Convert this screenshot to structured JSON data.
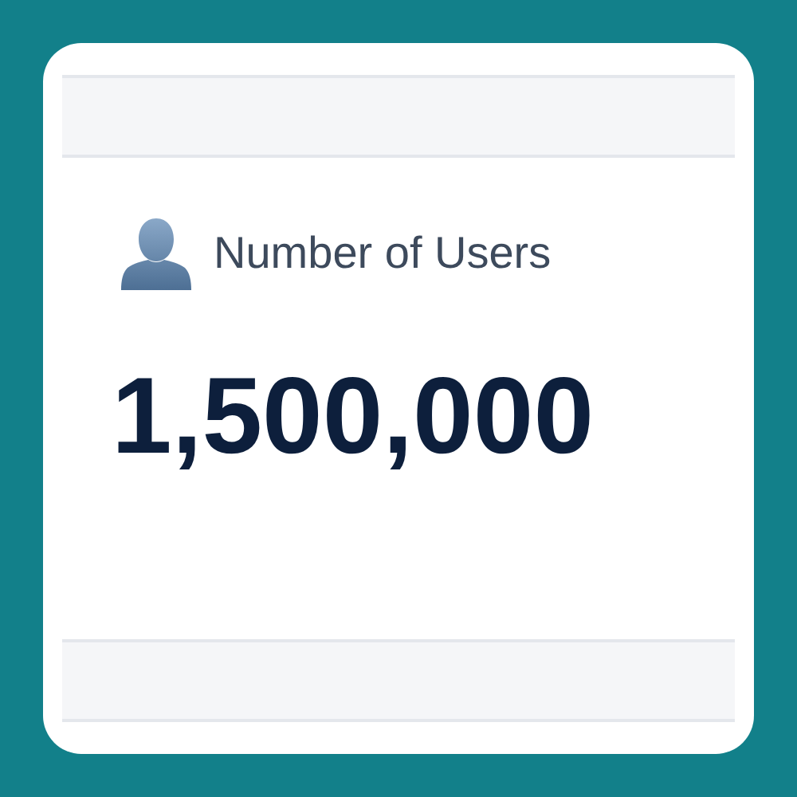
{
  "stat": {
    "label": "Number of Users",
    "value": "1,500,000"
  }
}
